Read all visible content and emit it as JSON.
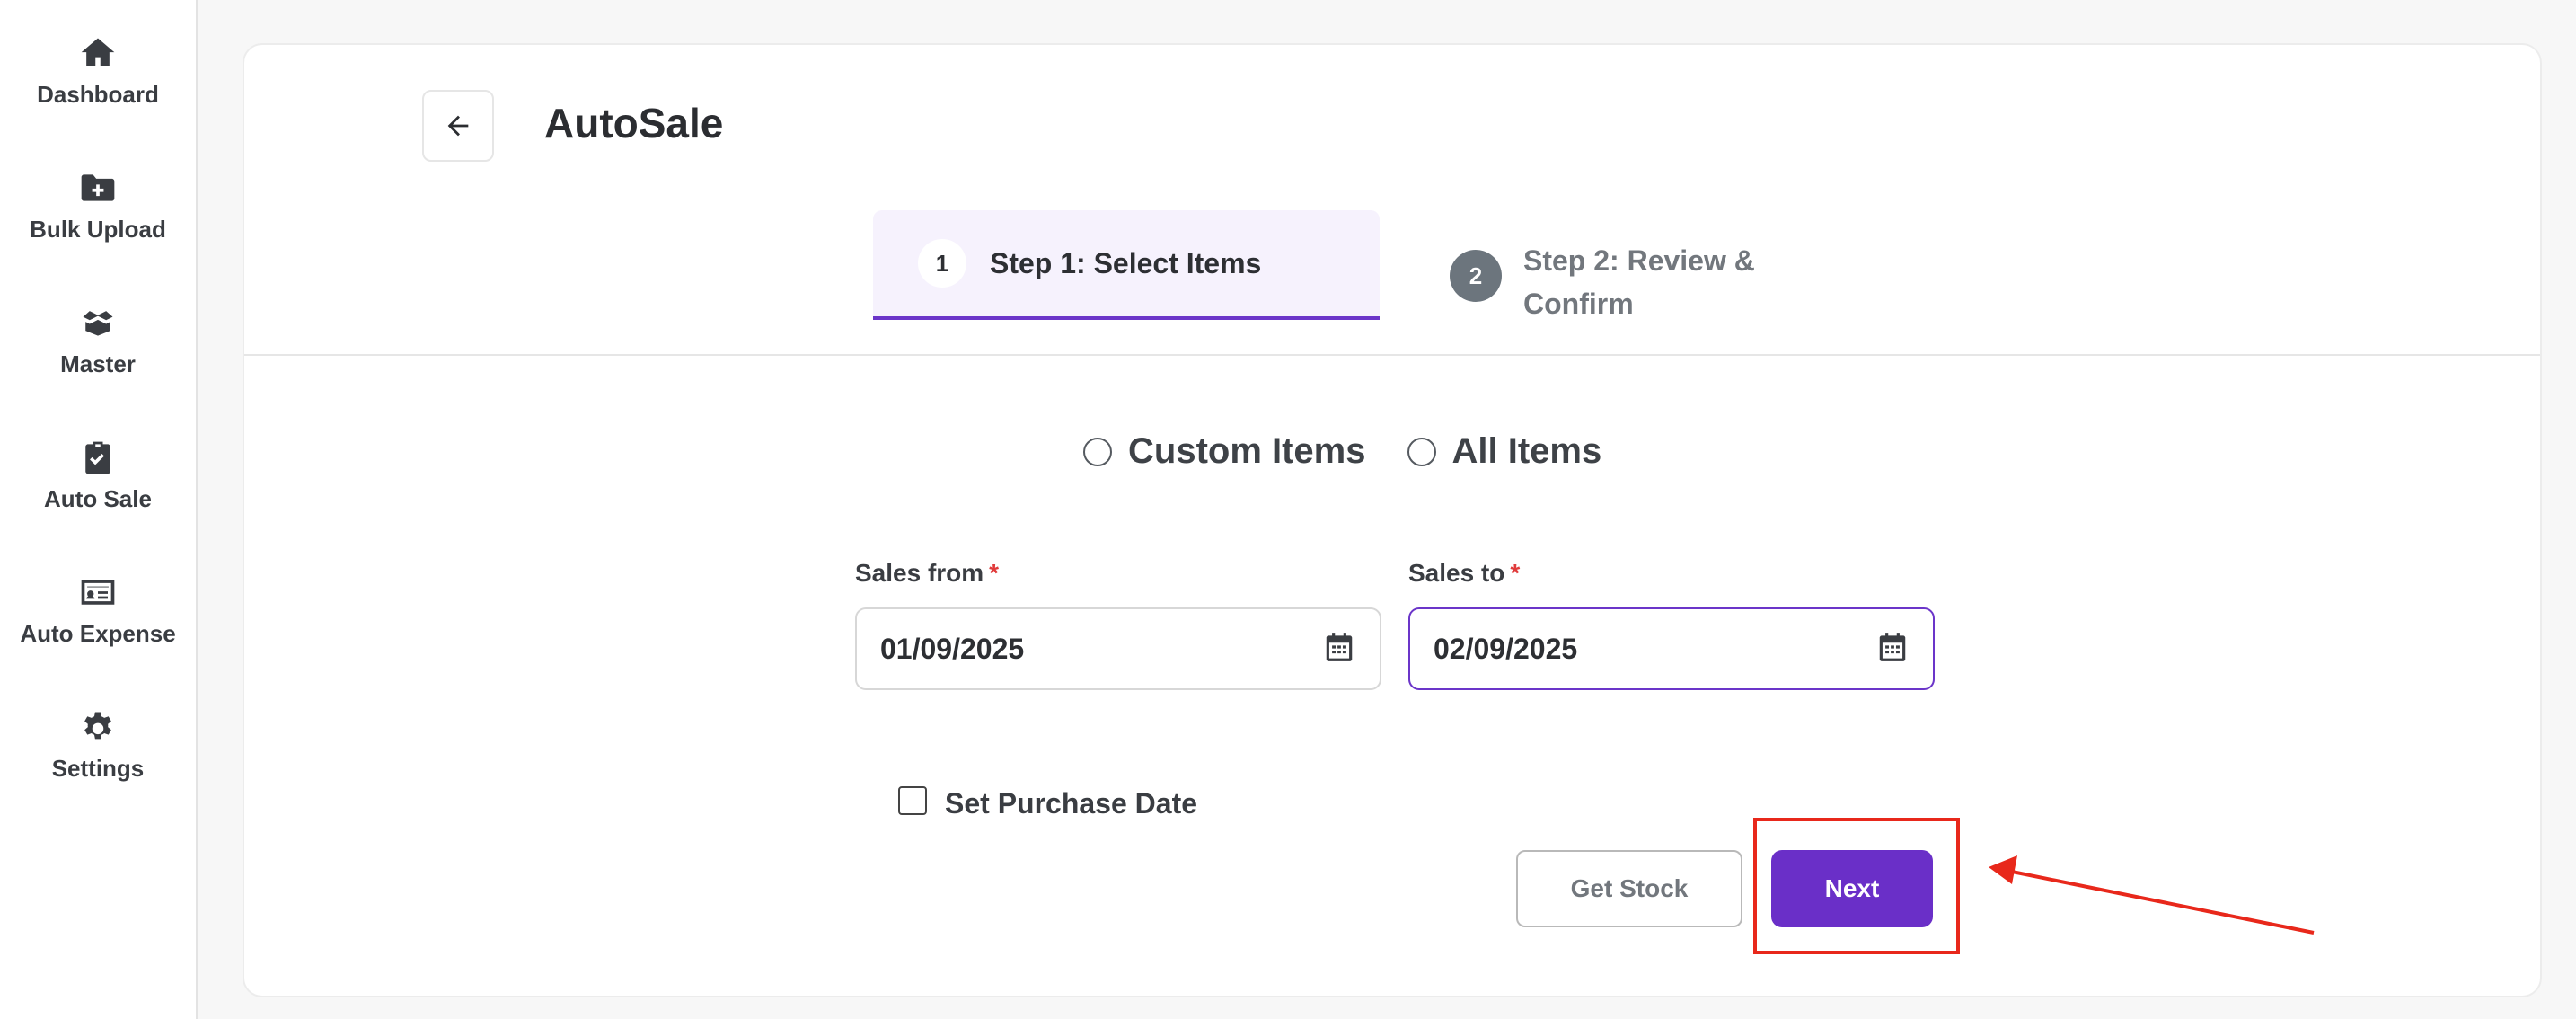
{
  "sidebar": {
    "items": [
      {
        "label": "Dashboard",
        "icon": "home-icon"
      },
      {
        "label": "Bulk Upload",
        "icon": "folder-plus-icon"
      },
      {
        "label": "Master",
        "icon": "box-open-icon"
      },
      {
        "label": "Auto Sale",
        "icon": "clipboard-check-icon"
      },
      {
        "label": "Auto Expense",
        "icon": "id-card-icon"
      },
      {
        "label": "Settings",
        "icon": "gear-icon"
      }
    ]
  },
  "header": {
    "title": "AutoSale",
    "back_icon": "arrow-left-icon"
  },
  "steps": [
    {
      "number": "1",
      "label": "Step 1: Select Items",
      "active": true
    },
    {
      "number": "2",
      "label": "Step 2: Review & Confirm",
      "active": false
    }
  ],
  "item_options": [
    {
      "label": "Custom Items",
      "selected": false
    },
    {
      "label": "All Items",
      "selected": false
    }
  ],
  "sales_from": {
    "label": "Sales from",
    "required_mark": "*",
    "value": "01/09/2025"
  },
  "sales_to": {
    "label": "Sales to",
    "required_mark": "*",
    "value": "02/09/2025"
  },
  "purchase_date": {
    "label": "Set Purchase Date",
    "checked": false
  },
  "buttons": {
    "get_stock": "Get Stock",
    "next": "Next"
  },
  "colors": {
    "accent": "#6a2fc8",
    "annotation": "#e8281b",
    "required": "#e03b3b"
  }
}
